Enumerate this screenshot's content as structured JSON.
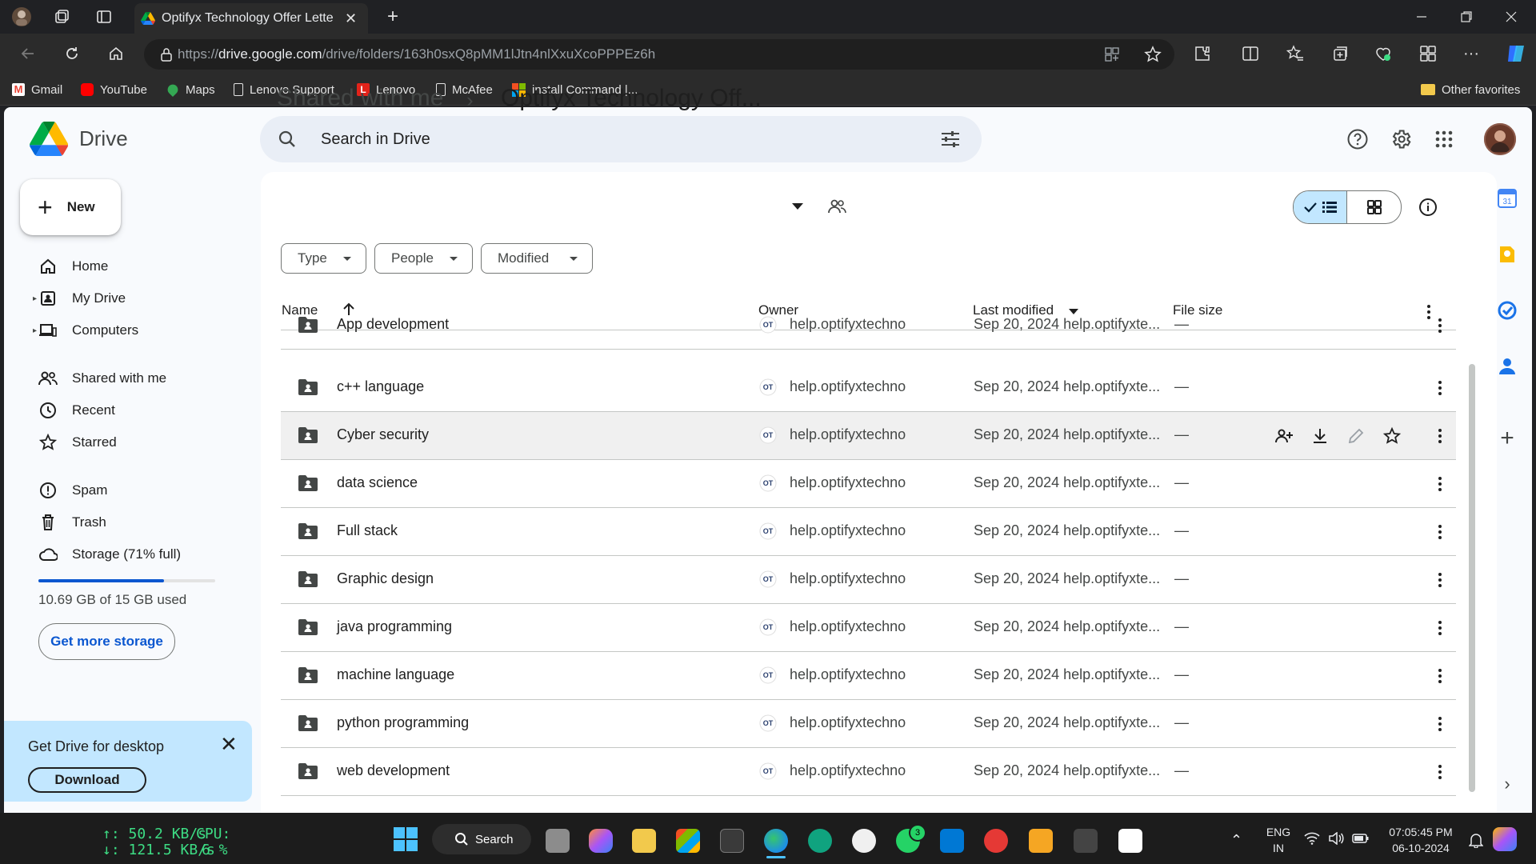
{
  "browser": {
    "tab_title": "Optifyx Technology Offer Letter -",
    "url_prefix": "https://",
    "url_host": "drive.google.com",
    "url_path": "/drive/folders/163h0sxQ8pMM1lJtn4nlXxuXcoPPPEz6h",
    "bookmarks": [
      "Gmail",
      "YouTube",
      "Maps",
      "Lenovo Support",
      "Lenovo",
      "McAfee",
      "install Command |...",
      "Other favorites"
    ]
  },
  "drive": {
    "logo_text": "Drive",
    "search_placeholder": "Search in Drive",
    "new_label": "New",
    "nav": {
      "home": "Home",
      "my_drive": "My Drive",
      "computers": "Computers",
      "shared": "Shared with me",
      "recent": "Recent",
      "starred": "Starred",
      "spam": "Spam",
      "trash": "Trash",
      "storage": "Storage (71% full)"
    },
    "storage_fraction": 0.71,
    "storage_used": "10.69 GB of 15 GB used",
    "get_more_storage": "Get more storage",
    "promo": {
      "title": "Get Drive for desktop",
      "button": "Download"
    },
    "breadcrumb": {
      "parent": "Shared with me",
      "current": "Optifyx Technology Off..."
    },
    "filters": {
      "type": "Type",
      "people": "People",
      "modified": "Modified"
    },
    "columns": {
      "name": "Name",
      "owner": "Owner",
      "last_modified": "Last modified",
      "file_size": "File size"
    },
    "rows": [
      {
        "name": "App development",
        "owner": "help.optifyxtechno",
        "modified": "Sep 20, 2024 help.optifyxte...",
        "size": "—"
      },
      {
        "name": "c++ language",
        "owner": "help.optifyxtechno",
        "modified": "Sep 20, 2024 help.optifyxte...",
        "size": "—"
      },
      {
        "name": "Cyber security",
        "owner": "help.optifyxtechno",
        "modified": "Sep 20, 2024 help.optifyxte...",
        "size": "—"
      },
      {
        "name": "data science",
        "owner": "help.optifyxtechno",
        "modified": "Sep 20, 2024 help.optifyxte...",
        "size": "—"
      },
      {
        "name": "Full stack",
        "owner": "help.optifyxtechno",
        "modified": "Sep 20, 2024 help.optifyxte...",
        "size": "—"
      },
      {
        "name": "Graphic design",
        "owner": "help.optifyxtechno",
        "modified": "Sep 20, 2024 help.optifyxte...",
        "size": "—"
      },
      {
        "name": "java programming",
        "owner": "help.optifyxtechno",
        "modified": "Sep 20, 2024 help.optifyxte...",
        "size": "—"
      },
      {
        "name": "machine language",
        "owner": "help.optifyxtechno",
        "modified": "Sep 20, 2024 help.optifyxte...",
        "size": "—"
      },
      {
        "name": "python programming",
        "owner": "help.optifyxtechno",
        "modified": "Sep 20, 2024 help.optifyxte...",
        "size": "—"
      },
      {
        "name": "web development",
        "owner": "help.optifyxtechno",
        "modified": "Sep 20, 2024 help.optifyxte...",
        "size": "—"
      }
    ]
  },
  "taskbar": {
    "net_up": "↑: 50.2 KB/s",
    "net_down": "↓: 121.5 KB/s",
    "cpu_label": "CPU:",
    "cpu_value": "6 %",
    "search": "Search",
    "lang": "ENG",
    "region": "IN",
    "time": "07:05:45 PM",
    "date": "06-10-2024",
    "whatsapp_badge": "3"
  },
  "colors": {
    "accent": "#0b57d0",
    "selected_toggle": "#c2e7ff",
    "promo_bg": "#c2e7ff"
  }
}
